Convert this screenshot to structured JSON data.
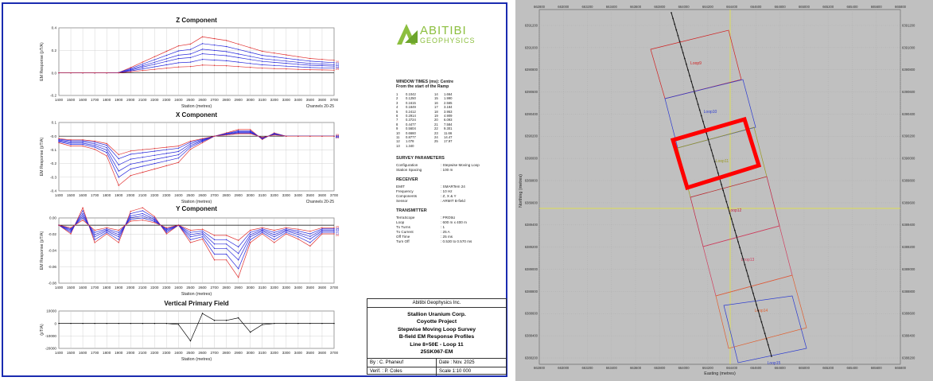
{
  "left": {
    "colors": {
      "frame": "#1a2bb0",
      "red": "#e03030",
      "blue": "#2b2bdc",
      "black": "#000000"
    },
    "charts": [
      {
        "title": "Z Component",
        "ylabel": "EM Response (pT/A)",
        "xlabel": "Station (metres)",
        "note": "Channels 20-25",
        "yticks": [
          "0.4",
          "0.2",
          "0.0",
          "-0.2"
        ],
        "ylim": [
          -0.2,
          0.4
        ],
        "end_labels": [
          "20",
          "21",
          "22",
          "23",
          "24",
          "25"
        ]
      },
      {
        "title": "X Component",
        "ylabel": "EM Response (pT/A)",
        "xlabel": "Station (metres)",
        "note": "Channels 20-25",
        "yticks": [
          "0.1",
          "-0.0",
          "-0.1",
          "-0.2",
          "-0.3",
          "-0.4"
        ],
        "ylim": [
          -0.4,
          0.1
        ],
        "end_labels": [
          "20",
          "21",
          "22",
          "23",
          "24",
          "25"
        ]
      },
      {
        "title": "Y Component",
        "ylabel": "EM Response (pT/A)",
        "xlabel": "Station (metres)",
        "note": "",
        "yticks": [
          "0.00",
          "-0.02",
          "-0.04",
          "-0.06",
          "-0.08"
        ],
        "ylim": [
          -0.08,
          0.01
        ],
        "end_labels": [
          "20",
          "21",
          "22",
          "23",
          "24",
          "25"
        ]
      },
      {
        "title": "Vertical Primary Field",
        "ylabel": "(pT/A)",
        "xlabel": "Station (metres)",
        "note": "",
        "yticks": [
          "10000",
          "0",
          "-10000",
          "-20000"
        ],
        "ylim": [
          -20000,
          10000
        ],
        "end_labels": []
      }
    ],
    "xticks": [
      "1400",
      "1500",
      "1600",
      "1700",
      "1800",
      "1900",
      "2000",
      "2100",
      "2200",
      "2300",
      "2400",
      "2500",
      "2600",
      "2700",
      "2800",
      "2900",
      "3000",
      "3100",
      "3200",
      "3300",
      "3400",
      "3500",
      "3600",
      "3700"
    ],
    "logo": {
      "name": "ABITIBI",
      "sub": "GEOPHYSICS"
    },
    "window_times": {
      "title": "WINDOW TIMES (ms): Centre",
      "subtitle": "From the start of the Ramp",
      "col1": [
        [
          "1",
          "0.1042"
        ],
        [
          "2",
          "0.1250"
        ],
        [
          "3",
          "0.1615"
        ],
        [
          "4",
          "0.1849"
        ],
        [
          "5",
          "0.2412"
        ],
        [
          "6",
          "0.2914"
        ],
        [
          "7",
          "0.3724"
        ],
        [
          "8",
          "0.4477"
        ],
        [
          "9",
          "0.5604"
        ],
        [
          "10",
          "0.6660"
        ],
        [
          "11",
          "0.8777"
        ],
        [
          "12",
          "1.078"
        ],
        [
          "13",
          "1.340"
        ]
      ],
      "col2": [
        [
          "14",
          "1.664"
        ],
        [
          "15",
          "1.990"
        ],
        [
          "16",
          "2.565"
        ],
        [
          "17",
          "3.184"
        ],
        [
          "18",
          "3.953"
        ],
        [
          "19",
          "4.909"
        ],
        [
          "20",
          "6.093"
        ],
        [
          "21",
          "7.584"
        ],
        [
          "22",
          "9.301"
        ],
        [
          "23",
          "11.66"
        ],
        [
          "24",
          "14.47"
        ],
        [
          "25",
          "17.97"
        ]
      ]
    },
    "survey": {
      "heading": "SURVEY PARAMETERS",
      "rows": [
        [
          "Configuration",
          ": Stepwise Moving Loop"
        ],
        [
          "Station Spacing",
          ": 100 m"
        ]
      ]
    },
    "receiver": {
      "heading": "RECEIVER",
      "rows": [
        [
          "EMIT",
          ": SMARTem 24"
        ],
        [
          "Frequency",
          ": 10 Hz"
        ],
        [
          "Components",
          ": Z, X & Y"
        ],
        [
          "Sensor",
          ": ARMIT B-field"
        ]
      ]
    },
    "transmitter": {
      "heading": "TRANSMITTER",
      "rows": [
        [
          "TerraScope",
          ": PRO5U"
        ],
        [
          "Loop",
          ": 600 m x 400 m"
        ],
        [
          "Tx Turns",
          ": 1"
        ],
        [
          "Tx Current",
          ": 25 A"
        ],
        [
          "Off Time",
          ": 25 ms"
        ],
        [
          "Turn Off",
          ": 0.530 to 0.570 ms"
        ]
      ]
    },
    "title_block": {
      "company": "Abitibi Geophysics Inc.",
      "lines": [
        "Stallion Uranium Corp.",
        "Coyotte Project",
        "Stepwise Moving Loop Survey",
        "B-field EM Response Profiles",
        "Line 8+50E - Loop 11",
        "25SK067-EM"
      ],
      "by": "By : C. Phaneuf",
      "date": "Date : Nov. 2025",
      "verif": "Verif. : P. Coles",
      "scale": "Scale 1:10 000"
    }
  },
  "right": {
    "bg": "#c0c0c0",
    "x_ticks": [
      "662800",
      "663000",
      "663200",
      "663400",
      "663600",
      "663800",
      "664000",
      "664200",
      "664400",
      "664600",
      "664800",
      "665000",
      "665200",
      "665400",
      "665600",
      "665800"
    ],
    "y_ticks": [
      "6391200",
      "6391000",
      "6390800",
      "6390600",
      "6390400",
      "6390200",
      "6390000",
      "6389800",
      "6389600",
      "6389400",
      "6389200",
      "6389000",
      "6388800",
      "6388600",
      "6388400",
      "6388200"
    ],
    "xlabel": "Easting (metres)",
    "ylabel": "Northing (metres)",
    "loops": [
      {
        "label": "Loop9",
        "color": "#d02020"
      },
      {
        "label": "Loop10",
        "color": "#2a3ad0"
      },
      {
        "label": "Loop11",
        "color": "#9a9a20"
      },
      {
        "label": "Loop12",
        "color": "#c02040"
      },
      {
        "label": "Loop13",
        "color": "#d04060"
      },
      {
        "label": "Loop14",
        "color": "#e06030"
      },
      {
        "label": "Loop15",
        "color": "#2a3ad0"
      }
    ],
    "highlight_color": "#ff0000"
  }
}
